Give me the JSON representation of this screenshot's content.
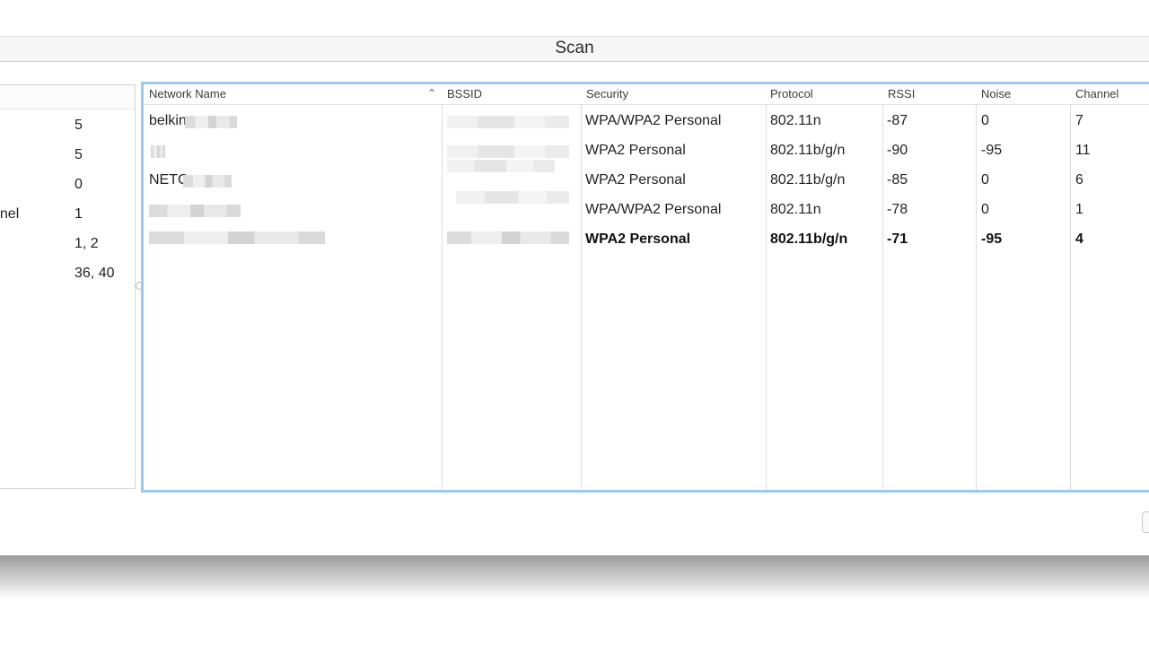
{
  "window": {
    "title": "Scan"
  },
  "left_panel": {
    "rows": [
      {
        "label": "",
        "value": "5"
      },
      {
        "label": "",
        "value": "5"
      },
      {
        "label": "",
        "value": "0"
      },
      {
        "label": "nnel",
        "value": "1"
      },
      {
        "label": "",
        "value": "1, 2"
      },
      {
        "label": "",
        "value": "36, 40"
      }
    ]
  },
  "table": {
    "columns": [
      "Network Name",
      "BSSID",
      "Security",
      "Protocol",
      "RSSI",
      "Noise",
      "Channel"
    ],
    "sort_column": "Network Name",
    "sort_icon": "chevron-up-icon",
    "rows": [
      {
        "name": "belkin",
        "bssid": "",
        "security": "WPA/WPA2 Personal",
        "protocol": "802.11n",
        "rssi": "-87",
        "noise": "0",
        "channel": "7",
        "selected": false
      },
      {
        "name": "",
        "bssid": "",
        "security": "WPA2 Personal",
        "protocol": "802.11b/g/n",
        "rssi": "-90",
        "noise": "-95",
        "channel": "11",
        "selected": false
      },
      {
        "name": "NETC",
        "bssid": "",
        "security": "WPA2 Personal",
        "protocol": "802.11b/g/n",
        "rssi": "-85",
        "noise": "0",
        "channel": "6",
        "selected": false
      },
      {
        "name": "",
        "bssid": "",
        "security": "WPA/WPA2 Personal",
        "protocol": "802.11n",
        "rssi": "-78",
        "noise": "0",
        "channel": "1",
        "selected": false
      },
      {
        "name": "",
        "bssid": "",
        "security": "WPA2 Personal",
        "protocol": "802.11b/g/n",
        "rssi": "-71",
        "noise": "-95",
        "channel": "4",
        "selected": true
      }
    ]
  },
  "colors": {
    "focus_ring": "#9cc8ee",
    "grid_line": "#dcdcdc"
  }
}
